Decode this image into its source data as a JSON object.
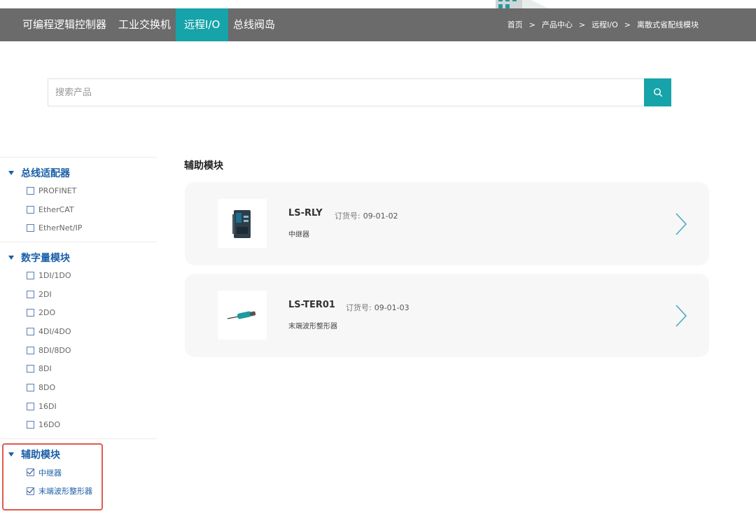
{
  "nav": {
    "tabs": [
      {
        "label": "可编程逻辑控制器",
        "active": false
      },
      {
        "label": "工业交换机",
        "active": false
      },
      {
        "label": "远程I/O",
        "active": true
      },
      {
        "label": "总线阀岛",
        "active": false
      }
    ],
    "breadcrumb": [
      "首页",
      "产品中心",
      "远程I/O",
      "离散式省配线模块"
    ],
    "breadcrumb_separator": ">"
  },
  "search": {
    "placeholder": "搜索产品",
    "value": ""
  },
  "sidebar": {
    "groups": [
      {
        "title": "总线适配器",
        "items": [
          {
            "label": "PROFINET",
            "checked": false
          },
          {
            "label": "EtherCAT",
            "checked": false
          },
          {
            "label": "EtherNet/IP",
            "checked": false
          }
        ]
      },
      {
        "title": "数字量模块",
        "items": [
          {
            "label": "1DI/1DO",
            "checked": false
          },
          {
            "label": "2DI",
            "checked": false
          },
          {
            "label": "2DO",
            "checked": false
          },
          {
            "label": "4DI/4DO",
            "checked": false
          },
          {
            "label": "8DI/8DO",
            "checked": false
          },
          {
            "label": "8DI",
            "checked": false
          },
          {
            "label": "8DO",
            "checked": false
          },
          {
            "label": "16DI",
            "checked": false
          },
          {
            "label": "16DO",
            "checked": false
          }
        ]
      },
      {
        "title": "辅助模块",
        "items": [
          {
            "label": "中继器",
            "checked": true
          },
          {
            "label": "末端波形整形器",
            "checked": true
          }
        ]
      }
    ]
  },
  "main": {
    "section_title": "辅助模块",
    "products": [
      {
        "model": "LS-RLY",
        "order_label": "订货号:",
        "order_no": "09-01-02",
        "desc": "中继器"
      },
      {
        "model": "LS-TER01",
        "order_label": "订货号:",
        "order_no": "09-01-03",
        "desc": "末端波形整形器"
      }
    ]
  },
  "colors": {
    "nav_bg": "#6b6b6b",
    "accent": "#16a3a9",
    "sidebar_title": "#1a5fa8",
    "highlight": "#e05a4e",
    "card_bg": "#f7f7f7"
  }
}
